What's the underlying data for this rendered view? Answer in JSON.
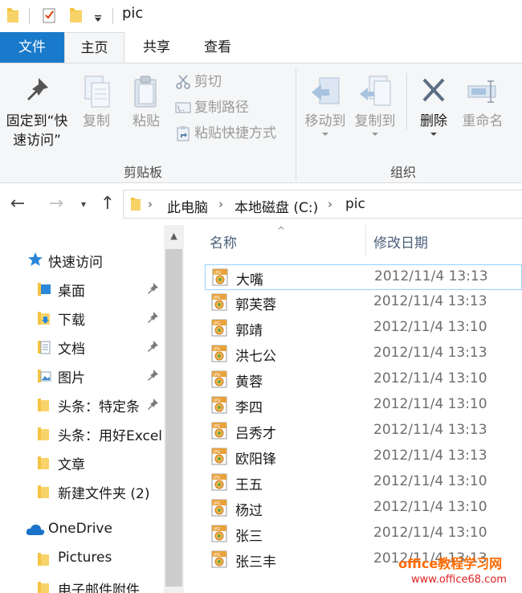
{
  "window": {
    "title": "pic"
  },
  "ribbon_tabs": {
    "file": "文件",
    "home": "主页",
    "share": "共享",
    "view": "查看"
  },
  "ribbon": {
    "pin_line1": "固定到“快",
    "pin_line2": "速访问”",
    "copy": "复制",
    "paste": "粘贴",
    "cut": "剪切",
    "copy_path": "复制路径",
    "paste_shortcut": "粘贴快捷方式",
    "clipboard_group": "剪贴板",
    "move_to": "移动到",
    "copy_to": "复制到",
    "delete": "删除",
    "rename": "重命名",
    "organize_group": "组织"
  },
  "address": {
    "crumbs": [
      "此电脑",
      "本地磁盘 (C:)",
      "pic"
    ]
  },
  "nav": {
    "quick_access": "快速访问",
    "items": [
      {
        "label": "桌面",
        "pinned": true
      },
      {
        "label": "下载",
        "pinned": true
      },
      {
        "label": "文档",
        "pinned": true
      },
      {
        "label": "图片",
        "pinned": true
      },
      {
        "label": "头条：特定条",
        "pinned": true
      },
      {
        "label": "头条：用好Excel",
        "pinned": false
      },
      {
        "label": "文章",
        "pinned": false
      },
      {
        "label": "新建文件夹 (2)",
        "pinned": false
      }
    ],
    "onedrive": "OneDrive",
    "onedrive_items": [
      "Pictures",
      "电子邮件附件"
    ]
  },
  "columns": {
    "name": "名称",
    "date": "修改日期"
  },
  "files": [
    {
      "name": "大嘴",
      "date": "2012/11/4 13:13"
    },
    {
      "name": "郭芙蓉",
      "date": "2012/11/4 13:13"
    },
    {
      "name": "郭靖",
      "date": "2012/11/4 13:10"
    },
    {
      "name": "洪七公",
      "date": "2012/11/4 13:13"
    },
    {
      "name": "黄蓉",
      "date": "2012/11/4 13:10"
    },
    {
      "name": "李四",
      "date": "2012/11/4 13:10"
    },
    {
      "name": "吕秀才",
      "date": "2012/11/4 13:13"
    },
    {
      "name": "欧阳锋",
      "date": "2012/11/4 13:13"
    },
    {
      "name": "王五",
      "date": "2012/11/4 13:10"
    },
    {
      "name": "杨过",
      "date": "2012/11/4 13:10"
    },
    {
      "name": "张三",
      "date": "2012/11/4 13:10"
    },
    {
      "name": "张三丰",
      "date": "2012/11/4 13:13"
    }
  ],
  "watermark": {
    "line1": "office教程学习网",
    "line2": "www.office68.com"
  },
  "colors": {
    "file_tab": "#1979ca",
    "ribbon_bg": "#f5f6f7",
    "folder": "#f5c342",
    "selection_border": "#99d1ff"
  }
}
